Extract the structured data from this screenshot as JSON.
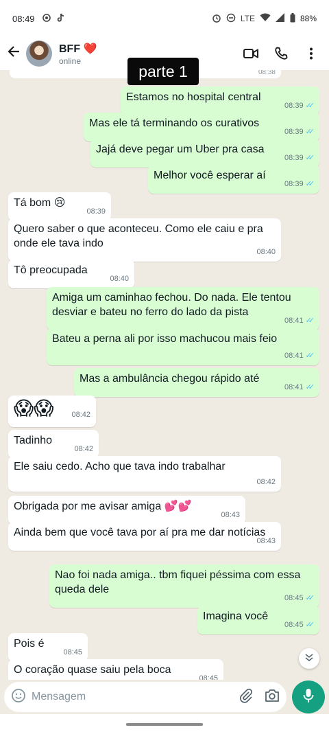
{
  "status_bar": {
    "time": "08:49",
    "battery": "88%",
    "network_label": "LTE"
  },
  "header": {
    "contact_name": "BFF",
    "heart": "❤️",
    "status": "online",
    "icons": [
      "back-arrow-icon",
      "video-call-icon",
      "phone-icon",
      "more-options-icon"
    ]
  },
  "overlay_label": "parte 1",
  "top_cut_time": "08:38",
  "messages": [
    {
      "dir": "out",
      "text": "Estamos no hospital central",
      "time": "08:39",
      "read": true
    },
    {
      "dir": "out",
      "text": "Mas ele tá terminando os curativos",
      "time": "08:39",
      "read": true
    },
    {
      "dir": "out",
      "text": "Jajá deve pegar um Uber pra casa",
      "time": "08:39",
      "read": true
    },
    {
      "dir": "out",
      "text": "Melhor você esperar aí",
      "time": "08:39",
      "read": true
    },
    {
      "dir": "in",
      "text": "Tá bom 😢",
      "time": "08:39"
    },
    {
      "dir": "in",
      "text": "Quero saber o que aconteceu. Como ele caiu e pra onde ele tava indo",
      "time": "08:40"
    },
    {
      "dir": "in",
      "text": "Tô preocupada",
      "time": "08:40"
    },
    {
      "dir": "out",
      "text": "Amiga um caminhao fechou. Do nada. Ele tentou desviar e bateu no ferro do lado da pista",
      "time": "08:41",
      "read": true
    },
    {
      "dir": "out",
      "text": "Bateu a perna ali por isso machucou mais feio",
      "time": "08:41",
      "read": true
    },
    {
      "dir": "out",
      "text": "Mas a ambulância chegou rápido até",
      "time": "08:41",
      "read": true
    },
    {
      "dir": "in",
      "text": "😱😱",
      "time": "08:42"
    },
    {
      "dir": "in",
      "text": "Tadinho",
      "time": "08:42"
    },
    {
      "dir": "in",
      "text": "Ele saiu cedo. Acho que tava indo trabalhar",
      "time": "08:42"
    },
    {
      "dir": "in",
      "text": "Obrigada por me avisar amiga 💕💕",
      "time": "08:43"
    },
    {
      "dir": "in",
      "text": "Ainda bem que você tava por aí pra me dar notícias",
      "time": "08:43"
    },
    {
      "dir": "out",
      "text": "Nao foi nada amiga.. tbm fiquei péssima com essa queda dele",
      "time": "08:45",
      "read": true
    },
    {
      "dir": "out",
      "text": "Imagina você",
      "time": "08:45",
      "read": true
    },
    {
      "dir": "in",
      "text": "Pois é",
      "time": "08:45"
    },
    {
      "dir": "in",
      "text": "O coração quase saiu pela boca",
      "time": "08:45"
    }
  ],
  "input": {
    "placeholder": "Mensagem"
  },
  "colors": {
    "incoming": "#ffffff",
    "outgoing": "#d9fdd3",
    "wallpaper": "#efeae2",
    "accent": "#15a181",
    "read_ticks": "#53bdeb"
  }
}
